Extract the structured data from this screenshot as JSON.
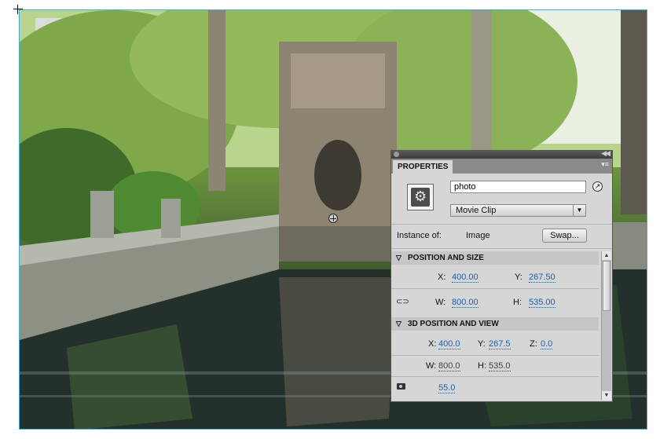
{
  "stage": {
    "instance_name": "photo"
  },
  "panel": {
    "tab_label": "PROPERTIES",
    "instance_name_value": "photo",
    "symbol_type": "Movie Clip",
    "instance_of_label": "Instance of:",
    "instance_of_value": "Image",
    "swap_label": "Swap...",
    "position_size": {
      "header": "POSITION AND SIZE",
      "x_label": "X:",
      "x_value": "400.00",
      "y_label": "Y:",
      "y_value": "267.50",
      "w_label": "W:",
      "w_value": "800.00",
      "h_label": "H:",
      "h_value": "535.00"
    },
    "position_3d": {
      "header": "3D POSITION AND VIEW",
      "x_label": "X:",
      "x_value": "400.0",
      "y_label": "Y:",
      "y_value": "267.5",
      "z_label": "Z:",
      "z_value": "0.0",
      "w_label": "W:",
      "w_value": "800.0",
      "h_label": "H:",
      "h_value": "535.0",
      "perspective_value": "55.0"
    }
  },
  "icons": [
    "symbol-icon",
    "edit-icon",
    "link-icon",
    "camera-icon"
  ],
  "colors": {
    "selection_border": "#3fb1d9",
    "link_value": "#1a5fb0"
  }
}
